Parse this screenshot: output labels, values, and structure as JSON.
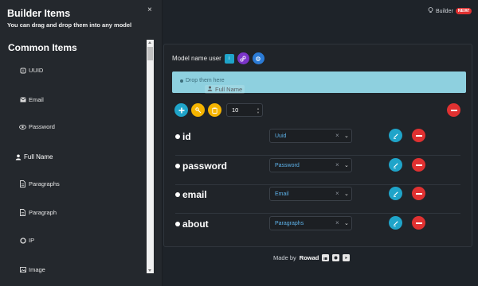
{
  "sidebar": {
    "title": "Builder Items",
    "subtitle": "You can drag and drop them into any model",
    "close_label": "×",
    "section_title": "Common Items",
    "items": [
      {
        "label": "UUID",
        "icon": "fingerprint-icon"
      },
      {
        "label": "Email",
        "icon": "envelope-icon"
      },
      {
        "label": "Password",
        "icon": "eye-icon"
      },
      {
        "label": "Full Name",
        "icon": "user-icon"
      },
      {
        "label": "Paragraphs",
        "icon": "document-icon"
      },
      {
        "label": "Paragraph",
        "icon": "document-icon"
      },
      {
        "label": "IP",
        "icon": "circle-icon"
      },
      {
        "label": "Image",
        "icon": "image-icon"
      }
    ]
  },
  "header": {
    "builder_label": "Builder",
    "new_badge": "NEW!"
  },
  "model": {
    "name_label": "Model name user",
    "dropzone_text": "Drop them here",
    "dragged_item": "Full Name",
    "count_value": "10"
  },
  "fields": [
    {
      "name": "id",
      "type": "Uuid"
    },
    {
      "name": "password",
      "type": "Password"
    },
    {
      "name": "email",
      "type": "Email"
    },
    {
      "name": "about",
      "type": "Paragraphs"
    }
  ],
  "footer": {
    "made_by": "Made by",
    "author": "Rowad"
  },
  "colors": {
    "background": "#1e2329",
    "sidebar": "#24282d",
    "dropzone": "#8ed0df",
    "accent_cyan": "#1fa4c9",
    "accent_red": "#e03131",
    "accent_amber": "#f5b400",
    "accent_purple": "#7b34c9",
    "accent_blue": "#2b7bd6",
    "select_text": "#5db1e8"
  }
}
